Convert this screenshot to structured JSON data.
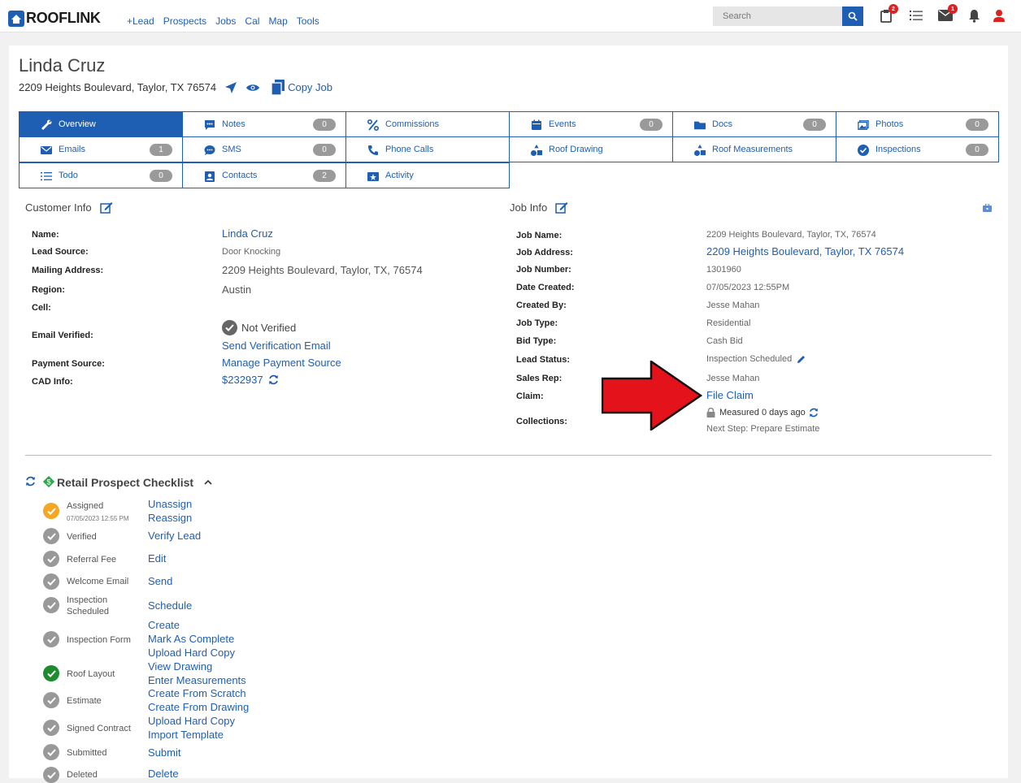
{
  "nav": {
    "logo": "ROOFLINK",
    "links": [
      "+Lead",
      "Prospects",
      "Jobs",
      "Cal",
      "Map",
      "Tools"
    ],
    "search_placeholder": "Search",
    "cart_badge": "2",
    "mail_badge": "1"
  },
  "customer": {
    "name": "Linda Cruz",
    "address": "2209 Heights Boulevard, Taylor, TX 76574",
    "copy_job": "Copy Job"
  },
  "tabs": [
    {
      "label": "Overview",
      "count": null,
      "icon": "wrench-icon",
      "active": true
    },
    {
      "label": "Notes",
      "count": "0",
      "icon": "chat-icon"
    },
    {
      "label": "Commissions",
      "count": null,
      "icon": "percent-icon"
    },
    {
      "label": "Events",
      "count": "0",
      "icon": "calendar-icon"
    },
    {
      "label": "Docs",
      "count": "0",
      "icon": "folder-icon"
    },
    {
      "label": "Photos",
      "count": "0",
      "icon": "photos-icon"
    },
    {
      "label": "Emails",
      "count": "1",
      "icon": "envelope-icon"
    },
    {
      "label": "SMS",
      "count": "0",
      "icon": "sms-icon"
    },
    {
      "label": "Phone Calls",
      "count": null,
      "icon": "phone-icon"
    },
    {
      "label": "Roof Drawing",
      "count": null,
      "icon": "shapes-icon"
    },
    {
      "label": "Roof Measurements",
      "count": null,
      "icon": "shapes-icon"
    },
    {
      "label": "Inspections",
      "count": "0",
      "icon": "check-circle-icon"
    },
    {
      "label": "Todo",
      "count": "0",
      "icon": "list-icon"
    },
    {
      "label": "Contacts",
      "count": "2",
      "icon": "contact-icon"
    },
    {
      "label": "Activity",
      "count": null,
      "icon": "activity-icon"
    }
  ],
  "customer_info": {
    "heading": "Customer Info",
    "labels": {
      "name": "Name:",
      "lead_source": "Lead Source:",
      "mailing_address": "Mailing Address:",
      "region": "Region:",
      "cell": "Cell:",
      "email_verified": "Email Verified:",
      "payment_source": "Payment Source:",
      "cad_info": "CAD Info:"
    },
    "values": {
      "name": "Linda Cruz",
      "lead_source": "Door Knocking",
      "mailing_address": "2209 Heights Boulevard, Taylor, TX, 76574",
      "region": "Austin",
      "cell": "",
      "email_verified": "Not Verified",
      "send_verification": "Send Verification Email",
      "payment_source": "Manage Payment Source",
      "cad_info": "$232937"
    }
  },
  "job_info": {
    "heading": "Job Info",
    "labels": {
      "job_name": "Job Name:",
      "job_address": "Job Address:",
      "job_number": "Job Number:",
      "date_created": "Date Created:",
      "created_by": "Created By:",
      "job_type": "Job Type:",
      "bid_type": "Bid Type:",
      "lead_status": "Lead Status:",
      "sales_rep": "Sales Rep:",
      "claim": "Claim:",
      "collections": "Collections:"
    },
    "values": {
      "job_name": "2209 Heights Boulevard, Taylor, TX, 76574",
      "job_address": "2209 Heights Boulevard, Taylor, TX 76574",
      "job_number": "1301960",
      "date_created": "07/05/2023 12:55PM",
      "created_by": "Jesse Mahan",
      "job_type": "Residential",
      "bid_type": "Cash Bid",
      "lead_status": "Inspection Scheduled",
      "sales_rep": "Jesse Mahan",
      "claim": "File Claim",
      "collections_measured": "Measured 0 days ago",
      "next_step": "Next Step: Prepare Estimate"
    }
  },
  "checklist": {
    "title": "Retail Prospect Checklist",
    "items": [
      {
        "label": "Assigned",
        "sub": "07/05/2023 12:55 PM",
        "status": "orange",
        "links": [
          "Unassign",
          "Reassign"
        ]
      },
      {
        "label": "Verified",
        "status": "gray",
        "links": [
          "Verify Lead"
        ]
      },
      {
        "label": "Referral Fee",
        "status": "gray",
        "links": [
          "Edit"
        ]
      },
      {
        "label": "Welcome Email",
        "status": "gray",
        "links": [
          "Send"
        ]
      },
      {
        "label": "Inspection",
        "label2": "Scheduled",
        "status": "gray",
        "links": [
          "Schedule"
        ]
      },
      {
        "label": "Inspection Form",
        "status": "gray",
        "links": [
          "Create",
          "Mark As Complete",
          "Upload Hard Copy"
        ]
      },
      {
        "label": "Roof Layout",
        "status": "green",
        "links": [
          "View Drawing",
          "Enter Measurements"
        ]
      },
      {
        "label": "Estimate",
        "status": "gray",
        "links": [
          "Create From Scratch",
          "Create From Drawing"
        ]
      },
      {
        "label": "Signed Contract",
        "status": "gray",
        "links": [
          "Upload Hard Copy",
          "Import Template"
        ]
      },
      {
        "label": "Submitted",
        "status": "gray",
        "links": [
          "Submit"
        ]
      },
      {
        "label": "Deleted",
        "status": "gray",
        "links": [
          "Delete"
        ]
      }
    ]
  },
  "colors": {
    "accent": "#1f5fb3",
    "arrow": "#e3121b",
    "orange": "#f5a623",
    "green": "#1e8c2e",
    "gray": "#999999"
  }
}
